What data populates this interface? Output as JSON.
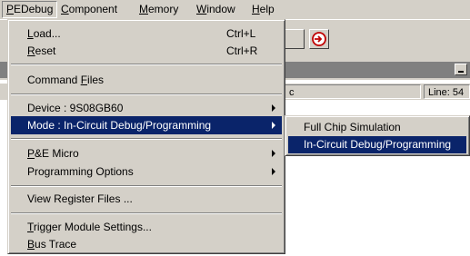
{
  "menubar": {
    "items": [
      {
        "label_pre": "",
        "label_ul": "P",
        "label_post": "EDebug"
      },
      {
        "label_pre": "",
        "label_ul": "C",
        "label_post": "omponent"
      },
      {
        "label_pre": "",
        "label_ul": "M",
        "label_post": "emory"
      },
      {
        "label_pre": "",
        "label_ul": "W",
        "label_post": "indow"
      },
      {
        "label_pre": "",
        "label_ul": "H",
        "label_post": "elp"
      }
    ]
  },
  "background": {
    "field_label": "c",
    "line_label": "Line: 54"
  },
  "menu": {
    "load": {
      "ul": "L",
      "rest": "oad...",
      "shortcut": "Ctrl+L"
    },
    "reset": {
      "ul": "R",
      "rest": "eset",
      "shortcut": "Ctrl+R"
    },
    "command_files": {
      "pre": "Command ",
      "ul": "F",
      "rest": "iles"
    },
    "device": {
      "label": "Device : 9S08GB60"
    },
    "mode": {
      "label": "Mode : In-Circuit Debug/Programming"
    },
    "pe_micro": {
      "ul": "P",
      "rest": "&E Micro"
    },
    "programming_options": {
      "label": "Programming Options"
    },
    "view_register_files": {
      "label": "View Register Files ..."
    },
    "trigger_module": {
      "ul": "T",
      "rest": "rigger Module Settings..."
    },
    "bus_trace": {
      "ul": "B",
      "rest": "us Trace"
    }
  },
  "submenu": {
    "items": [
      "Full Chip Simulation",
      "In-Circuit Debug/Programming"
    ]
  },
  "colors": {
    "highlight": "#0a246a",
    "face": "#d4d0c8"
  }
}
